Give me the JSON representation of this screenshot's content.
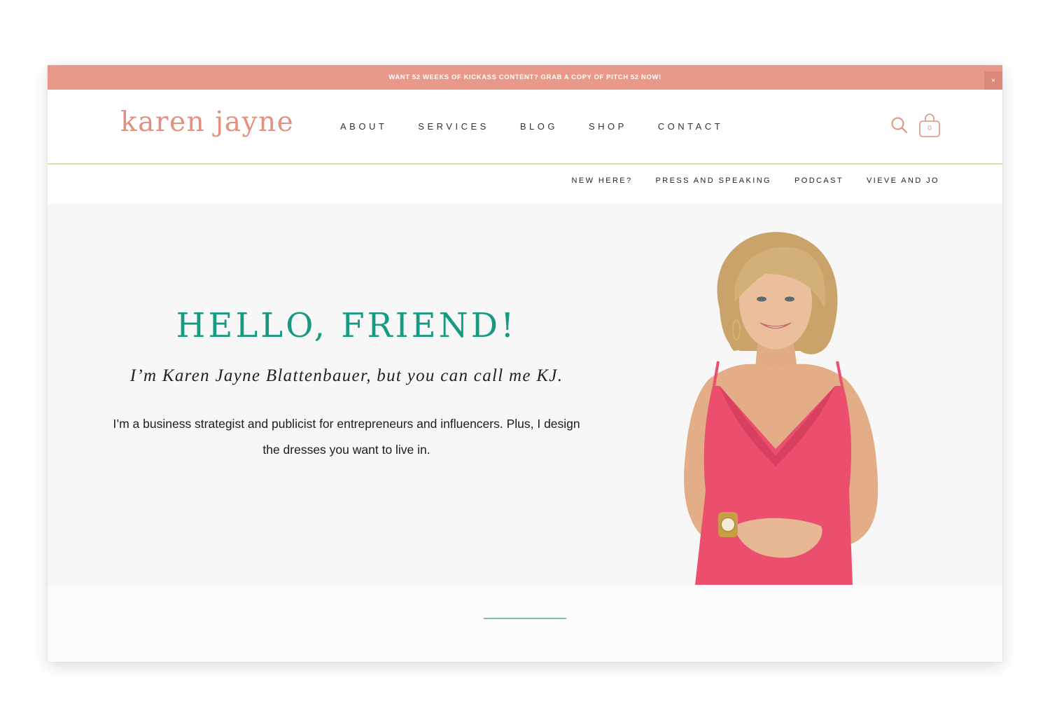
{
  "announcement": {
    "text": "WANT 52 WEEKS OF KICKASS CONTENT? GRAB A COPY OF PITCH 52 NOW!",
    "close_label": "×"
  },
  "header": {
    "logo": "karen jayne",
    "nav": [
      {
        "label": "ABOUT"
      },
      {
        "label": "SERVICES"
      },
      {
        "label": "BLOG"
      },
      {
        "label": "SHOP"
      },
      {
        "label": "CONTACT"
      }
    ],
    "icons": {
      "search": "search-icon",
      "cart": "shopping-bag-icon"
    },
    "cart_count": "0"
  },
  "subnav": [
    {
      "label": "NEW HERE?"
    },
    {
      "label": "PRESS AND SPEAKING"
    },
    {
      "label": "PODCAST"
    },
    {
      "label": "VIEVE AND JO"
    }
  ],
  "hero": {
    "title": "HELLO, FRIEND!",
    "subtitle": "I’m Karen Jayne Blattenbauer, but you can call me KJ.",
    "body": "I’m a business strategist and publicist for entrepreneurs and influencers. Plus, I design the dresses you want to live in."
  },
  "colors": {
    "accent_coral": "#e9998a",
    "logo_coral": "#e2917f",
    "title_teal": "#179a82",
    "rule_green": "#d5e4a8",
    "dress_pink": "#ec4f6e"
  }
}
